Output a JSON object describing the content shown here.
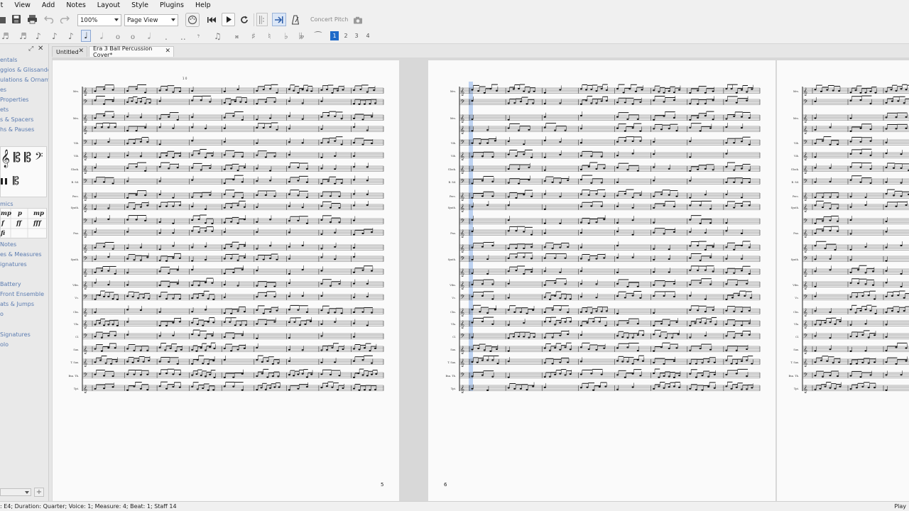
{
  "menu": [
    "it",
    "View",
    "Add",
    "Notes",
    "Layout",
    "Style",
    "Plugins",
    "Help"
  ],
  "toolbar": {
    "zoom_value": "100%",
    "view_mode": "Page View",
    "concert_pitch_label": "Concert Pitch"
  },
  "voices": [
    "1",
    "2",
    "3",
    "4"
  ],
  "palette": {
    "items_top": [
      "entals",
      "ggios & Glissandos",
      "ulations & Ornament",
      "es",
      "Properties",
      "ets",
      "s & Spacers",
      "hs & Pauses"
    ],
    "dynamics_label": "mics",
    "dynamics": [
      "mp",
      "p",
      "mp",
      "f",
      "ff",
      "fff",
      "fi"
    ],
    "items_bottom": [
      "Notes",
      "es & Measures",
      "ignatures",
      "Battery",
      "Front Ensemble",
      "ats & Jumps",
      "o",
      "Signatures",
      "olo"
    ]
  },
  "tabs": [
    {
      "label": "Untitled",
      "active": false
    },
    {
      "label": "Era 3 Ball Percussion Cover*",
      "active": true
    }
  ],
  "score": {
    "measure_number": "1 0",
    "page_numbers": [
      "5",
      "6"
    ],
    "staff_abbrev": [
      "Mrs.",
      "",
      "Mrs.",
      "",
      "Vib.",
      "Vib.",
      "Glock.",
      "B. Sd.",
      "Perc.",
      "Synth.",
      "",
      "Pno.",
      "",
      "Synth.",
      "",
      "Vibs.",
      "Vc.",
      "Cbs.",
      "Vla.",
      "Cl.",
      "Sax.",
      "T. Sax.",
      "Bsn. Tb.",
      "Tpt."
    ]
  },
  "status": {
    "text": ": E4; Duration: Quarter; Voice: 1;  Measure: 4; Beat: 1; Staff 14",
    "mode": "Play"
  },
  "colors": {
    "accent": "#1e6ac8",
    "selection": "#a8c4ee",
    "palette_link": "#5a7bb0"
  }
}
